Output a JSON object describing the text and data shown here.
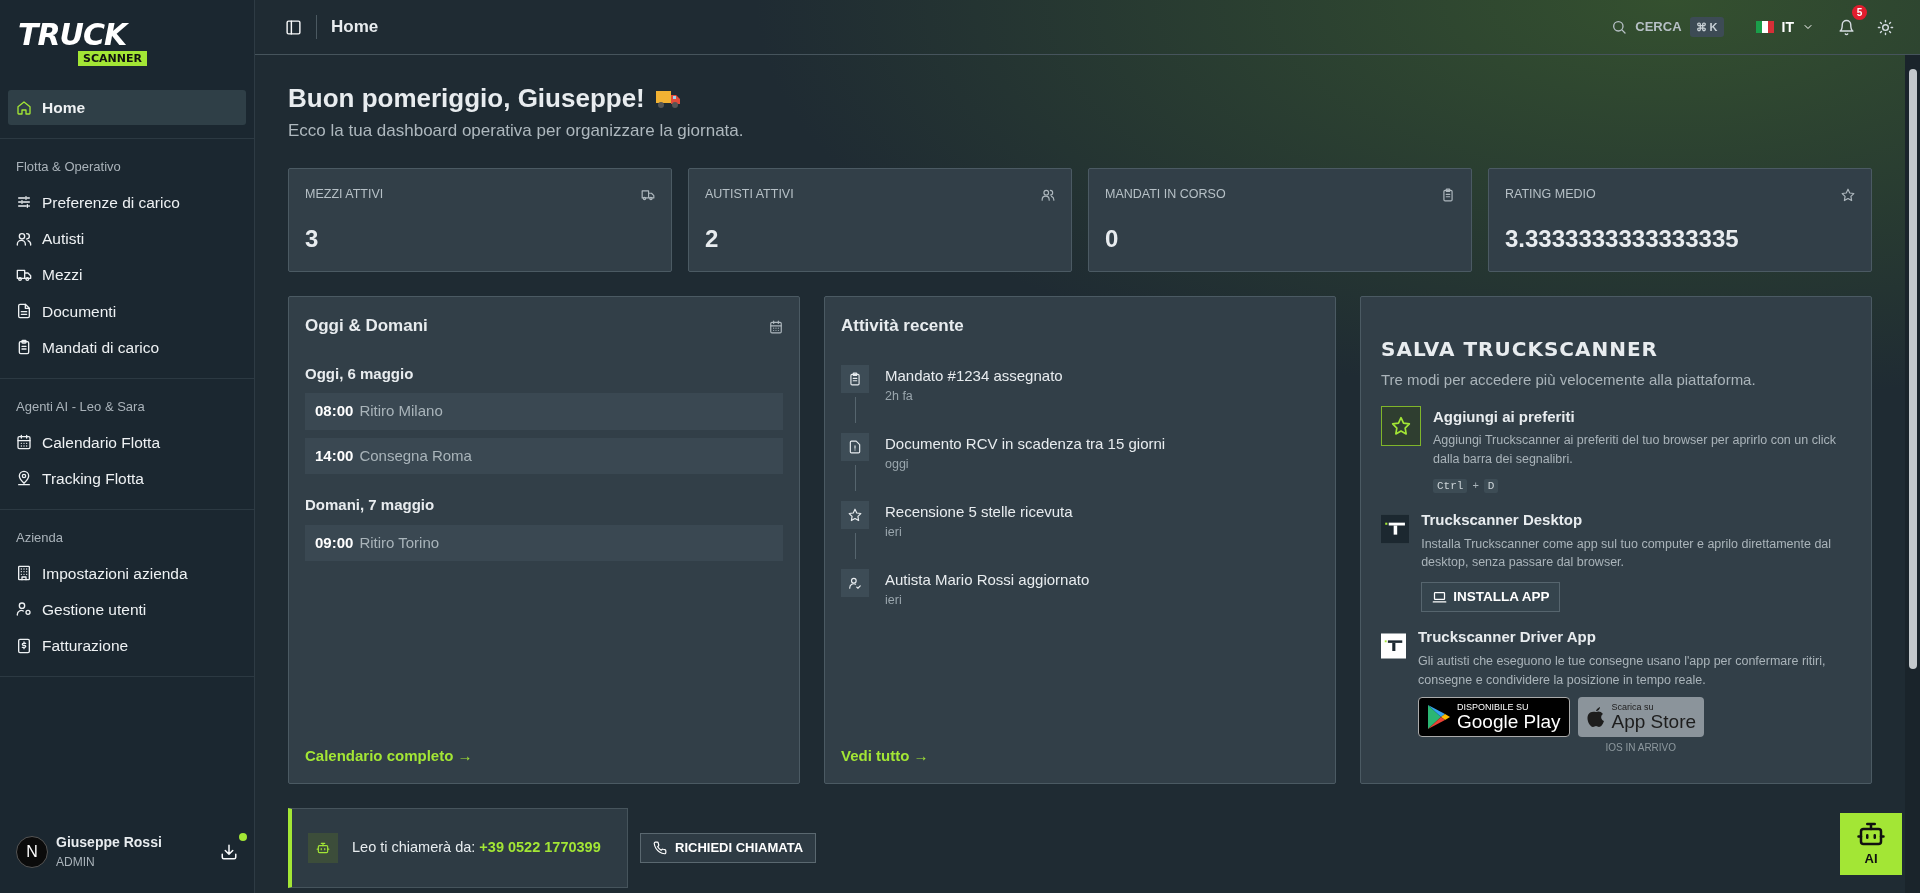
{
  "logo": {
    "word": "TRUCK",
    "tag": "SCANNER"
  },
  "sidebar": {
    "sections": [
      {
        "items": [
          {
            "label": "Home",
            "kind": "home",
            "selected": true
          }
        ]
      },
      {
        "title": "Flotta & Operativo",
        "items": [
          {
            "label": "Preferenze di carico",
            "kind": "sliders",
            "selected": false
          },
          {
            "label": "Autisti",
            "kind": "users",
            "selected": false
          },
          {
            "label": "Mezzi",
            "kind": "truck",
            "selected": false
          },
          {
            "label": "Documenti",
            "kind": "file",
            "selected": false
          },
          {
            "label": "Mandati di carico",
            "kind": "clipboard",
            "selected": false
          }
        ]
      },
      {
        "title": "Agenti AI - Leo & Sara",
        "items": [
          {
            "label": "Calendario Flotta",
            "kind": "calendar",
            "selected": false
          },
          {
            "label": "Tracking Flotta",
            "kind": "pin",
            "selected": false
          }
        ]
      },
      {
        "title": "Azienda",
        "items": [
          {
            "label": "Impostazioni azienda",
            "kind": "building",
            "selected": false
          },
          {
            "label": "Gestione utenti",
            "kind": "usergear",
            "selected": false
          },
          {
            "label": "Fatturazione",
            "kind": "receipt",
            "selected": false
          }
        ]
      }
    ],
    "user": {
      "initial": "N",
      "name": "Giuseppe Rossi",
      "role": "ADMIN"
    }
  },
  "topbar": {
    "title": "Home",
    "search": {
      "label": "CERCA",
      "keys": [
        "⌘",
        "K"
      ]
    },
    "language": "IT",
    "notifications": "5"
  },
  "greeting": {
    "title": "Buon pomeriggio, Giuseppe!",
    "subtitle": "Ecco la tua dashboard operativa per organizzare la giornata."
  },
  "stats": [
    {
      "label": "MEZZI ATTIVI",
      "value": "3",
      "kind": "truck"
    },
    {
      "label": "AUTISTI ATTIVI",
      "value": "2",
      "kind": "users"
    },
    {
      "label": "MANDATI IN CORSO",
      "value": "0",
      "kind": "clipboard"
    },
    {
      "label": "RATING MEDIO",
      "value": "3.3333333333333335",
      "kind": "star"
    }
  ],
  "agenda": {
    "title": "Oggi & Domani",
    "days": [
      {
        "heading": "Oggi, 6 maggio",
        "events": [
          {
            "time": "08:00",
            "label": "Ritiro Milano"
          },
          {
            "time": "14:00",
            "label": "Consegna Roma"
          }
        ]
      },
      {
        "heading": "Domani, 7 maggio",
        "events": [
          {
            "time": "09:00",
            "label": "Ritiro Torino"
          }
        ]
      }
    ],
    "link": "Calendario completo →"
  },
  "activity": {
    "title": "Attività recente",
    "items": [
      {
        "title": "Mandato #1234 assegnato",
        "time": "2h fa",
        "kind": "clipboard"
      },
      {
        "title": "Documento RCV in scadenza tra 15 giorni",
        "time": "oggi",
        "kind": "alert"
      },
      {
        "title": "Recensione 5 stelle ricevuta",
        "time": "ieri",
        "kind": "star"
      },
      {
        "title": "Autista Mario Rossi aggiornato",
        "time": "ieri",
        "kind": "usercheck"
      }
    ],
    "link": "Vedi tutto →"
  },
  "save_panel": {
    "title": "SALVA TRUCKSCANNER",
    "subtitle": "Tre modi per accedere più velocemente alla piattaforma.",
    "items": [
      {
        "kind": "bookmark",
        "title": "Aggiungi ai preferiti",
        "text": "Aggiungi Truckscanner ai preferiti del tuo browser per aprirlo con un click dalla barra dei segnalibri.",
        "keys": [
          "Ctrl",
          "+",
          "D"
        ]
      },
      {
        "kind": "desktop",
        "title": "Truckscanner Desktop",
        "text": "Installa Truckscanner come app sul tuo computer e aprilo direttamente dal desktop, senza passare dal browser.",
        "button": "INSTALLA APP"
      },
      {
        "kind": "driver",
        "title": "Truckscanner Driver App",
        "text": "Gli autisti che eseguono le tue consegne usano l'app per confermare ritiri, consegne e condividere la posizione in tempo reale.",
        "stores": [
          {
            "kind": "google",
            "small": "DISPONIBILE SU",
            "big": "Google Play"
          },
          {
            "kind": "apple",
            "small": "Scarica su",
            "big": "App Store",
            "note": "IOS IN ARRIVO"
          }
        ]
      }
    ]
  },
  "call_banner": {
    "text": "Leo ti chiamerà da:",
    "phone": "+39 0522 1770399",
    "button": "RICHIEDI CHIAMATA"
  },
  "ai_button": "AI"
}
